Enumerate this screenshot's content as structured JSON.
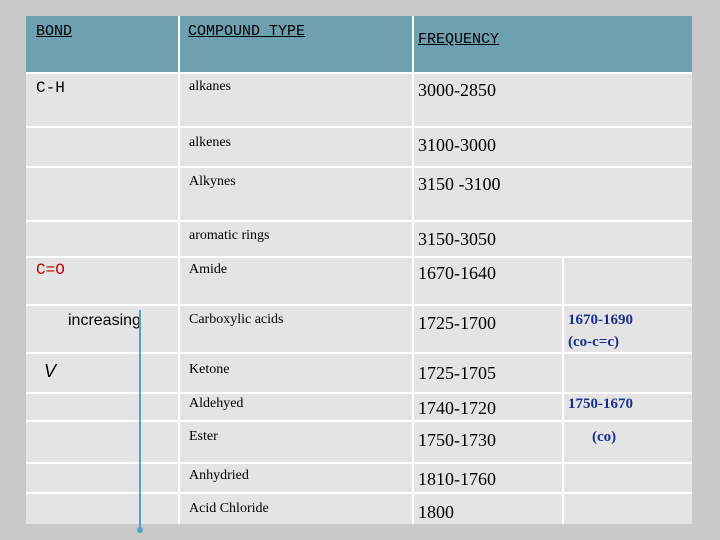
{
  "headers": {
    "bond": "BOND",
    "compound_type": "COMPOUND TYPE",
    "frequency": "FREQUENCY"
  },
  "bonds": {
    "ch": "C-H",
    "co": "C=O"
  },
  "rows": [
    {
      "compound": "alkanes",
      "frequency": "3000-2850"
    },
    {
      "compound": "alkenes",
      "frequency": "3100-3000"
    },
    {
      "compound": "Alkynes",
      "frequency": "3150 -3100"
    },
    {
      "compound": "aromatic rings",
      "frequency": "3150-3050"
    },
    {
      "compound": "Amide",
      "frequency": "1670-1640"
    },
    {
      "compound": "Carboxylic acids",
      "frequency": "1725-1700"
    },
    {
      "compound": "Ketone",
      "frequency": "1725-1705"
    },
    {
      "compound": "Aldehyed",
      "frequency": "1740-1720"
    },
    {
      "compound": "Ester",
      "frequency": "1750-1730"
    },
    {
      "compound": "Anhydried",
      "frequency": "1810-1760"
    },
    {
      "compound": "Acid Chloride",
      "frequency": "1800"
    }
  ],
  "side_notes": {
    "conj_range": "1670-1690",
    "conj_label": "(co-c=c)",
    "co_range": "1750-1670",
    "co_label": "(co)"
  },
  "annotation": {
    "increasing": "increasing",
    "v": "V"
  },
  "colors": {
    "header": "#6fa0b0",
    "row": "#e4e4e4",
    "bond_label": "#c00000",
    "side_note": "#1c2e8c",
    "arrow": "#5aa0c4"
  }
}
